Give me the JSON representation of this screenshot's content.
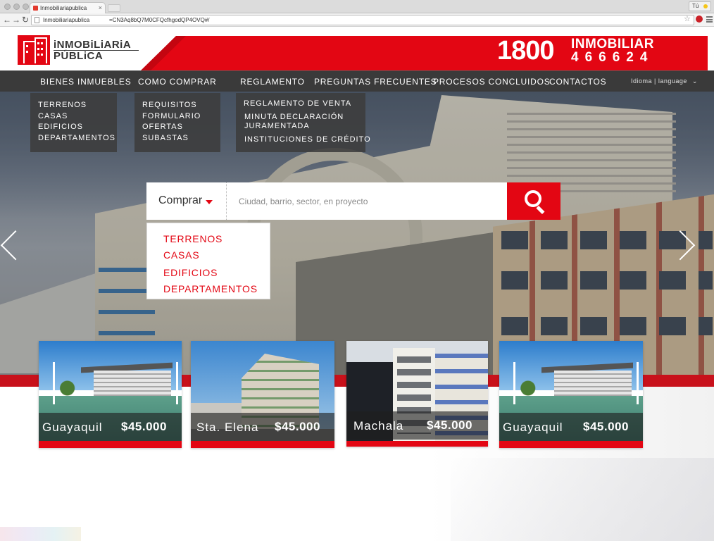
{
  "browser": {
    "tab_title": "Inmobiliariapublica",
    "tab_close": "×",
    "profile_label": "Tú",
    "url_host": "Inmobiliariapublica",
    "url_rest": "=CN3Aq8bQ7M0CFQcfhgodQP4OVQ#/",
    "back": "←",
    "forward": "→",
    "reload": "↻",
    "star": "☆"
  },
  "logo": {
    "line1": "iNMOBiLiARiA",
    "line2": "PÚBLiCA"
  },
  "phone": {
    "number": "1800",
    "word": "INMOBILIAR",
    "digits": "466624"
  },
  "nav": {
    "items": [
      "BIENES INMUEBLES",
      "COMO COMPRAR",
      "REGLAMENTO",
      "PREGUNTAS FRECUENTES",
      "PROCESOS CONCLUIDOS",
      "CONTACTOS"
    ],
    "language": "Idioma | language",
    "language_chevron": "⌄"
  },
  "menus": {
    "bienes": [
      "TERRENOS",
      "CASAS",
      "EDIFICIOS",
      "DEPARTAMENTOS"
    ],
    "comprar": [
      "REQUISITOS",
      "FORMULARIO",
      "OFERTAS",
      "SUBASTAS"
    ],
    "reglamento": [
      "REGLAMENTO DE  VENTA",
      "MINUTA DECLARACIÓN",
      "JURAMENTADA",
      "INSTITUCIONES DE CRÉDITO"
    ]
  },
  "search": {
    "type_label": "Comprar",
    "placeholder": "Ciudad, barrio, sector, en proyecto",
    "options": [
      "TERRENOS",
      "CASAS",
      "EDIFICIOS",
      "DEPARTAMENTOS"
    ]
  },
  "cards": [
    {
      "city": "Guayaquil",
      "price": "$45.000"
    },
    {
      "city": "Sta. Elena",
      "price": "$45.000"
    },
    {
      "city": "Machala",
      "price": "$45.000"
    },
    {
      "city": "Guayaquil",
      "price": "$45.000"
    }
  ],
  "colors": {
    "brand_red": "#e30613",
    "nav_dark": "#3a3a3a",
    "dropdown_overlay": "rgba(60,60,60,0.88)"
  },
  "icons": {
    "search": "search-icon",
    "prev": "chevron-left-icon",
    "next": "chevron-right-icon",
    "caret": "caret-down-icon"
  }
}
